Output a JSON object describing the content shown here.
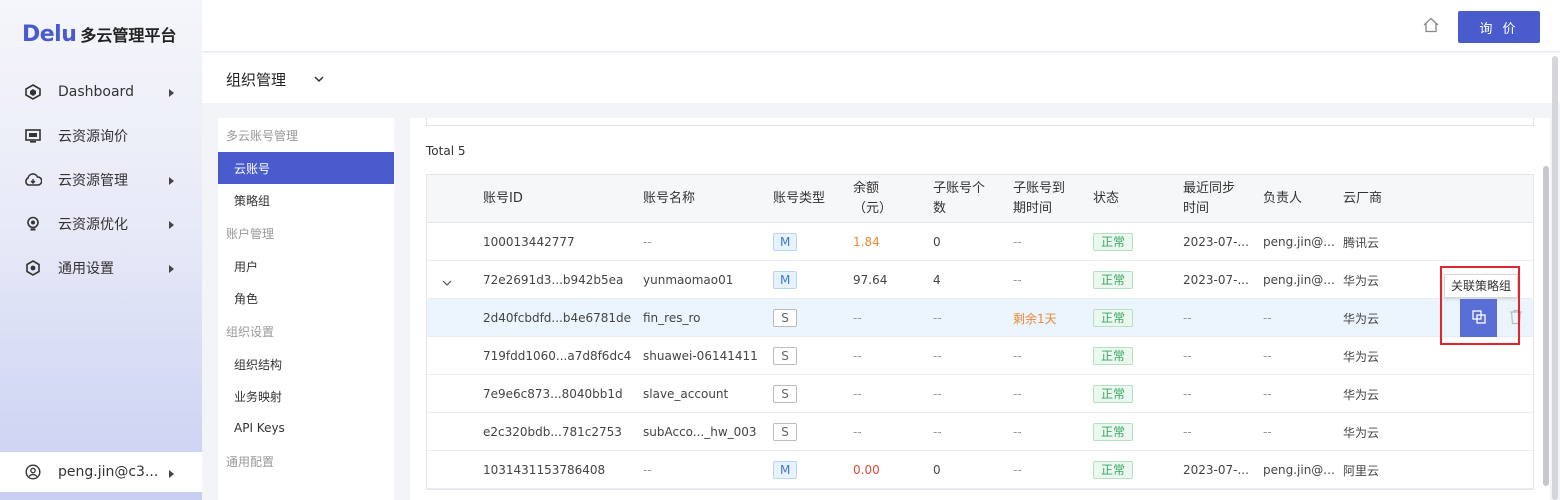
{
  "brand": {
    "logo": "Delu",
    "title": "多云管理平台"
  },
  "sidebar": {
    "items": [
      {
        "label": "Dashboard",
        "icon": "dashboard-icon",
        "has_arrow": true
      },
      {
        "label": "云资源询价",
        "icon": "monitor-icon",
        "has_arrow": false
      },
      {
        "label": "云资源管理",
        "icon": "cloud-icon",
        "has_arrow": true
      },
      {
        "label": "云资源优化",
        "icon": "bulb-icon",
        "has_arrow": true
      },
      {
        "label": "通用设置",
        "icon": "settings-icon",
        "has_arrow": true
      }
    ],
    "user": "peng.jin@c3..."
  },
  "header": {
    "inquiry_label": "询 价"
  },
  "page": {
    "title": "组织管理"
  },
  "submenu": {
    "groups": [
      {
        "title": "多云账号管理",
        "items": [
          {
            "label": "云账号",
            "active": true
          },
          {
            "label": "策略组",
            "active": false
          }
        ]
      },
      {
        "title": "账户管理",
        "items": [
          {
            "label": "用户",
            "active": false
          },
          {
            "label": "角色",
            "active": false
          }
        ]
      },
      {
        "title": "组织设置",
        "items": [
          {
            "label": "组织结构",
            "active": false
          },
          {
            "label": "业务映射",
            "active": false
          },
          {
            "label": "API Keys",
            "active": false
          }
        ]
      },
      {
        "title": "通用配置",
        "items": []
      }
    ]
  },
  "table": {
    "total": "Total 5",
    "columns": [
      "账号ID",
      "账号名称",
      "账号类型",
      "余额\n（元）",
      "子账号个\n数",
      "子账号到\n期时间",
      "状态",
      "最近同步\n时间",
      "负责人",
      "云厂商"
    ],
    "rows": [
      {
        "id": "100013442777",
        "name": "--",
        "type": "M",
        "balance": "1.84",
        "balance_color": "orange",
        "sub_count": "0",
        "expire": "--",
        "expire_color": "muted",
        "status": "正常",
        "sync": "2023-07-...",
        "owner": "peng.jin@...",
        "vendor": "腾讯云",
        "expander": false,
        "highlight": false
      },
      {
        "id": "72e2691d3...b942b5ea",
        "name": "yunmaomao01",
        "type": "M",
        "balance": "97.64",
        "balance_color": "",
        "sub_count": "4",
        "expire": "--",
        "expire_color": "muted",
        "status": "正常",
        "sync": "2023-07-...",
        "owner": "peng.jin@...",
        "vendor": "华为云",
        "expander": true,
        "highlight": false
      },
      {
        "id": "2d40fcbdfd...b4e6781de",
        "name": "fin_res_ro",
        "type": "S",
        "balance": "--",
        "balance_color": "muted",
        "sub_count": "--",
        "expire": "剩余1天",
        "expire_color": "orange",
        "status": "正常",
        "sync": "--",
        "owner": "--",
        "vendor": "华为云",
        "expander": false,
        "highlight": true
      },
      {
        "id": "719fdd1060...a7d8f6dc4",
        "name": "shuawei-06141411",
        "type": "S",
        "balance": "--",
        "balance_color": "muted",
        "sub_count": "--",
        "expire": "--",
        "expire_color": "muted",
        "status": "正常",
        "sync": "--",
        "owner": "--",
        "vendor": "华为云",
        "expander": false,
        "highlight": false
      },
      {
        "id": "7e9e6c873...8040bb1d",
        "name": "slave_account",
        "type": "S",
        "balance": "--",
        "balance_color": "muted",
        "sub_count": "--",
        "expire": "--",
        "expire_color": "muted",
        "status": "正常",
        "sync": "--",
        "owner": "--",
        "vendor": "华为云",
        "expander": false,
        "highlight": false
      },
      {
        "id": "e2c320bdb...781c2753",
        "name": "subAcco..._hw_003",
        "type": "S",
        "balance": "--",
        "balance_color": "muted",
        "sub_count": "--",
        "expire": "--",
        "expire_color": "muted",
        "status": "正常",
        "sync": "--",
        "owner": "--",
        "vendor": "华为云",
        "expander": false,
        "highlight": false
      },
      {
        "id": "1031431153786408",
        "name": "--",
        "type": "M",
        "balance": "0.00",
        "balance_color": "red",
        "sub_count": "0",
        "expire": "--",
        "expire_color": "muted",
        "status": "正常",
        "sync": "2023-07-...",
        "owner": "peng.jin@...",
        "vendor": "阿里云",
        "expander": false,
        "highlight": false
      }
    ]
  },
  "tooltip": {
    "label": "关联策略组"
  },
  "colors": {
    "accent": "#4a5ccd",
    "status_ok": "#3aa862",
    "warning": "#e58b37",
    "danger": "#e04a3b",
    "highlight_box": "#e3242b"
  }
}
